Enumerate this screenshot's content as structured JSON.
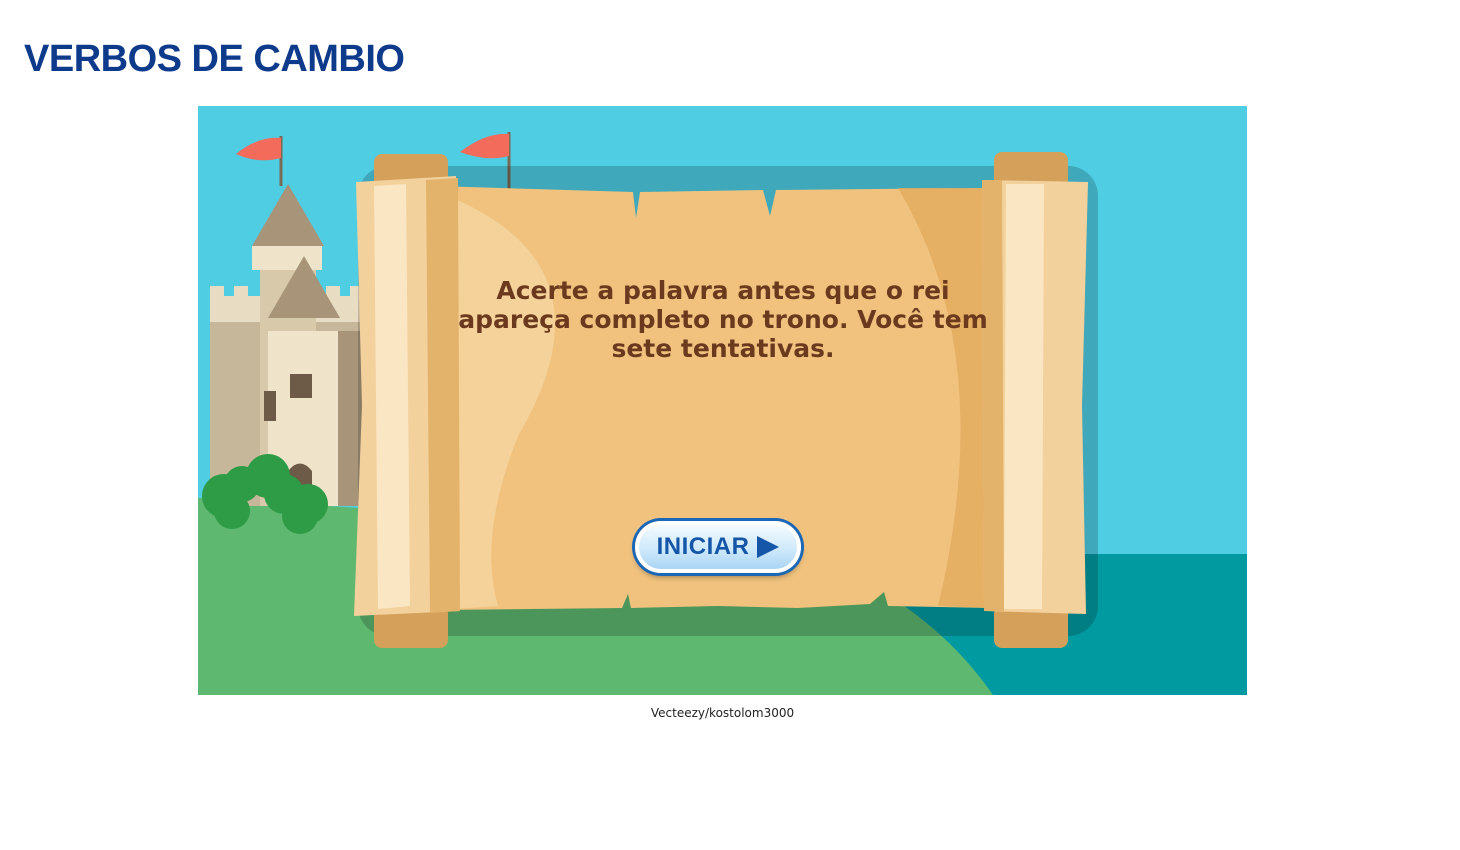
{
  "page": {
    "title": "VERBOS DE CAMBIO"
  },
  "game": {
    "instructions": "Acerte a palavra antes que o rei apareça completo no trono. Você tem sete tentativas.",
    "start_button": {
      "label": "INICIAR",
      "icon": "play-icon"
    },
    "colors": {
      "sky": "#4ecde3",
      "grass": "#5fb86f",
      "sea": "#009aa0",
      "scroll": "#f0c27e",
      "text": "#6b3a1e",
      "button": "#1556a8"
    }
  },
  "credit": "Vecteezy/kostolom3000"
}
